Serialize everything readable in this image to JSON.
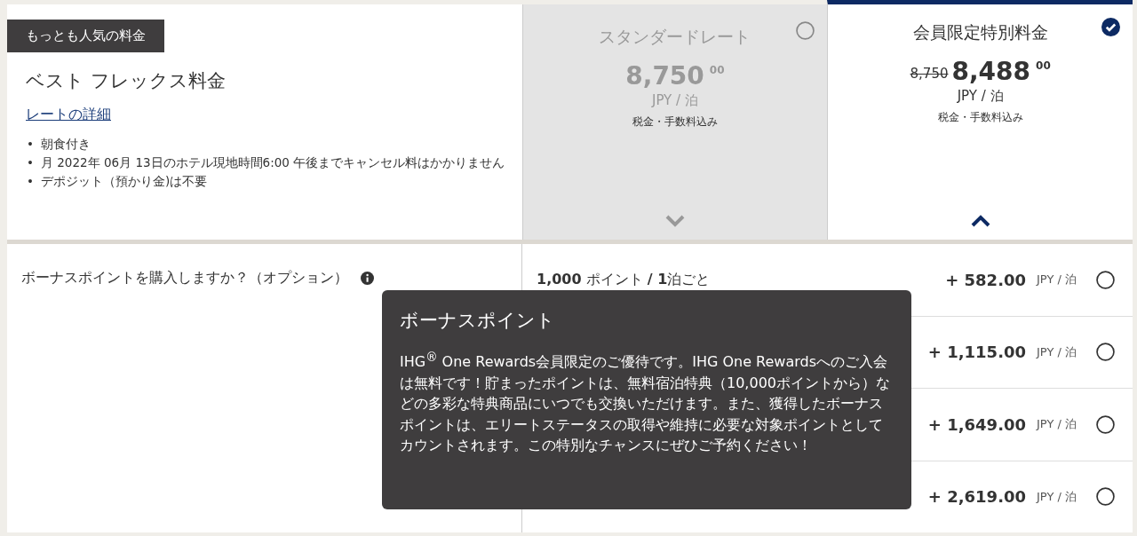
{
  "featured": {
    "badge": "もっとも人気の料金",
    "title": "ベスト フレックス料金",
    "details_link": "レートの詳細",
    "bullet": "•",
    "bullets": [
      "朝食付き",
      "月 2022年 06月 13日のホテル現地時間6:00 午後までキャンセル料はかかりません",
      "デポジット（預かり金)は不要"
    ]
  },
  "rates": [
    {
      "title": "スタンダードレート",
      "price": "8,750",
      "cents": "00",
      "unit": "JPY / 泊",
      "tax_note": "税金・手数料込み",
      "selected": false,
      "expanded": false
    },
    {
      "title": "会員限定特別料金",
      "original_price": "8,750",
      "price": "8,488",
      "cents": "00",
      "unit": "JPY / 泊",
      "tax_note": "税金・手数料込み",
      "selected": true,
      "expanded": true
    }
  ],
  "bonus": {
    "question": "ボーナスポイントを購入しますか？（オプション）",
    "options": [
      {
        "label": "**1,000** ポイント **/ 1**泊ごと",
        "price": "+ 582.00",
        "unit": "JPY / 泊",
        "selected": false
      },
      {
        "price": "+ 1,115.00",
        "unit": "JPY / 泊",
        "selected": false
      },
      {
        "price": "+ 1,649.00",
        "unit": "JPY / 泊",
        "selected": false
      },
      {
        "price": "+ 2,619.00",
        "unit": "JPY / 泊",
        "selected": false
      }
    ]
  },
  "tooltip": {
    "title": "ボーナスポイント",
    "body": "IHG$^{®}$ One Rewards会員限定のご優待です。IHG One Rewardsへのご入会は無料です！貯まったポイントは、無料宿泊特典（10,000ポイントから）などの多彩な特典商品にいつでも交換いただけます。また、獲得したボーナスポイントは、エリートステータスの取得や維持に必要な対象ポイントとしてカウントされます。この特別なチャンスにぜひご予約ください！"
  }
}
